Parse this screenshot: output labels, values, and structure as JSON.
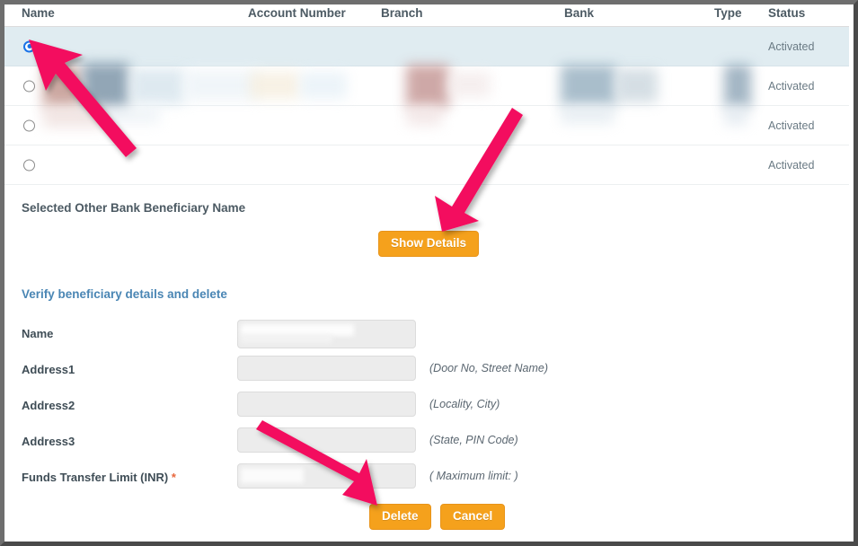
{
  "table": {
    "columns": [
      {
        "key": "name",
        "label": "Name"
      },
      {
        "key": "account",
        "label": "Account Number"
      },
      {
        "key": "branch",
        "label": "Branch"
      },
      {
        "key": "bank",
        "label": "Bank"
      },
      {
        "key": "type",
        "label": "Type"
      },
      {
        "key": "status",
        "label": "Status"
      }
    ],
    "rows": [
      {
        "selected": true,
        "status": "Activated"
      },
      {
        "selected": false,
        "status": "Activated"
      },
      {
        "selected": false,
        "status": "Activated"
      },
      {
        "selected": false,
        "status": "Activated"
      }
    ]
  },
  "middle": {
    "selected_beneficiary_label": "Selected Other Bank Beneficiary Name",
    "show_details_label": "Show Details"
  },
  "form": {
    "heading": "Verify beneficiary details and delete",
    "fields": [
      {
        "label": "Name",
        "required": false,
        "value": "",
        "hint": ""
      },
      {
        "label": "Address1",
        "required": false,
        "value": "",
        "hint": "(Door No, Street Name)"
      },
      {
        "label": "Address2",
        "required": false,
        "value": "",
        "hint": "(Locality, City)"
      },
      {
        "label": "Address3",
        "required": false,
        "value": "",
        "hint": "(State, PIN Code)"
      },
      {
        "label": "Funds Transfer Limit (INR)",
        "required": true,
        "value": "",
        "hint": "( Maximum limit: )"
      }
    ],
    "required_marker": "*",
    "delete_label": "Delete",
    "cancel_label": "Cancel"
  },
  "annotations": {
    "arrow_color": "#F3115E",
    "arrows": [
      {
        "name": "arrow-to-selected-radio",
        "points_to": "row-1-radio"
      },
      {
        "name": "arrow-to-show-details",
        "points_to": "show-details-button"
      },
      {
        "name": "arrow-to-delete",
        "points_to": "delete-button"
      }
    ]
  },
  "colors": {
    "button_orange": "#F5A11C",
    "selected_row": "#E0ECF1",
    "heading_blue": "#4A86B4",
    "radio_blue": "#1A73E8",
    "required_red": "#E8663C"
  }
}
